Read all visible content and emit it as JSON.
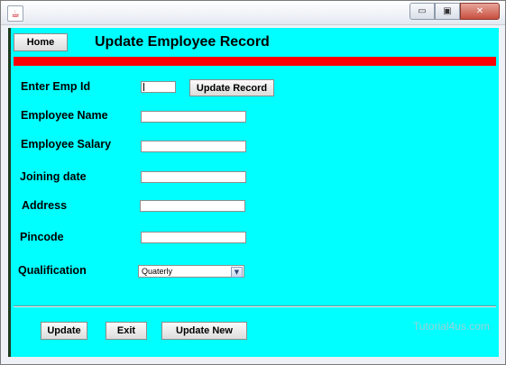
{
  "window": {
    "app_icon": "java-cup-icon",
    "controls": {
      "minimize": "▭",
      "maximize": "▣",
      "close": "✕"
    }
  },
  "header": {
    "home_label": "Home",
    "title": "Update Employee Record",
    "accent_color": "#ff0000",
    "background_color": "#00ffff"
  },
  "form": {
    "emp_id": {
      "label": "Enter Emp Id",
      "value": ""
    },
    "update_record_label": "Update Record",
    "name": {
      "label": "Employee Name",
      "value": ""
    },
    "salary": {
      "label": "Employee Salary",
      "value": ""
    },
    "joining": {
      "label": "Joining date",
      "value": ""
    },
    "address": {
      "label": "Address",
      "value": ""
    },
    "pincode": {
      "label": "Pincode",
      "value": ""
    },
    "qualification": {
      "label": "Qualification",
      "selected": "Quaterly"
    }
  },
  "footer": {
    "update_label": "Update",
    "exit_label": "Exit",
    "update_new_label": "Update New",
    "watermark": "Tutorial4us.com"
  }
}
